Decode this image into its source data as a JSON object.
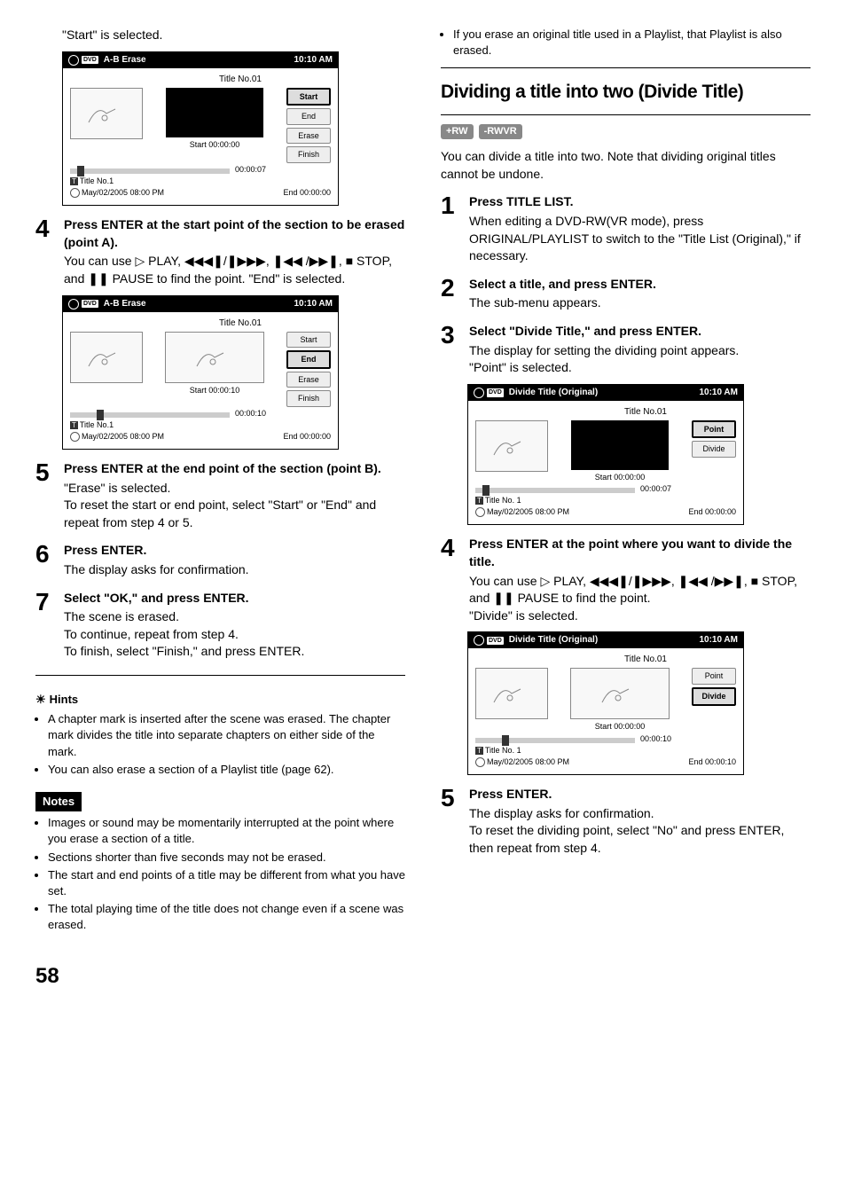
{
  "left": {
    "intro": "\"Start\" is selected.",
    "panel1": {
      "header_left": "A-B Erase",
      "header_right": "10:10 AM",
      "titleno": "Title No.01",
      "start_cap": "Start  00:00:00",
      "end_cap": "End   00:00:00",
      "elapsed": "00:00:07",
      "titleline": "Title No.1",
      "dateline": "May/02/2005  08:00  PM",
      "btns": [
        "Start",
        "End",
        "Erase",
        "Finish"
      ],
      "highlight": 0
    },
    "step4": {
      "num": "4",
      "head": "Press ENTER at the start point of the section to be erased (point A).",
      "body_a": "You can use ",
      "body_b": " PLAY, ",
      "body_c": ", ",
      "body_d": " STOP, and ",
      "body_e": " PAUSE to find the point. \"End\" is selected.",
      "play": "▷",
      "prev": "◀◀◀❚",
      "next": "❚▶▶▶",
      "skipb": "❚◀◀",
      "skipf": "▶▶❚",
      "stop": "■",
      "pause": "❚❚",
      "sep": "/"
    },
    "panel2": {
      "header_left": "A-B Erase",
      "header_right": "10:10 AM",
      "titleno": "Title No.01",
      "start_cap": "Start  00:00:10",
      "end_cap": "End   00:00:00",
      "elapsed": "00:00:10",
      "titleline": "Title No.1",
      "dateline": "May/02/2005  08:00  PM",
      "btns": [
        "Start",
        "End",
        "Erase",
        "Finish"
      ],
      "highlight": 1,
      "second_thumb": true
    },
    "step5": {
      "num": "5",
      "head": "Press ENTER at the end point of the section (point B).",
      "body": "\"Erase\" is selected.\nTo reset the start or end point, select \"Start\" or \"End\" and repeat from step 4 or 5."
    },
    "step6": {
      "num": "6",
      "head": "Press ENTER.",
      "body": "The display asks for confirmation."
    },
    "step7": {
      "num": "7",
      "head": "Select \"OK,\" and press ENTER.",
      "body": "The scene is erased.\nTo continue, repeat from step 4.\nTo finish, select \"Finish,\" and press ENTER."
    },
    "hints_head": "Hints",
    "hints": [
      "A chapter mark is inserted after the scene was erased. The chapter mark divides the title into separate chapters on either side of the mark.",
      "You can also erase a section of a Playlist title (page 62)."
    ],
    "notes_head": "Notes",
    "notes": [
      "Images or sound may be momentarily interrupted at the point where you erase a section of a title.",
      "Sections shorter than five seconds may not be erased.",
      "The start and end points of a title may be different from what you have set.",
      "The total playing time of the title does not change even if a scene was erased."
    ]
  },
  "right": {
    "top_bullet": "If you erase an original title used in a Playlist, that Playlist is also erased.",
    "section": "Dividing a title into two (Divide Title)",
    "badges": [
      "+RW",
      "-RWVR"
    ],
    "intro": "You can divide a title into two. Note that dividing original titles cannot be undone.",
    "step1": {
      "num": "1",
      "head": "Press TITLE LIST.",
      "body": "When editing a DVD-RW(VR mode), press ORIGINAL/PLAYLIST to switch to the \"Title List (Original),\" if necessary."
    },
    "step2": {
      "num": "2",
      "head": "Select a title, and press ENTER.",
      "body": "The sub-menu appears."
    },
    "step3": {
      "num": "3",
      "head": "Select \"Divide Title,\" and press ENTER.",
      "body": "The display for setting the dividing point appears.\n\"Point\" is selected."
    },
    "panel3": {
      "header_left": "Divide Title (Original)",
      "header_right": "10:10 AM",
      "titleno": "Title No.01",
      "start_cap": "Start  00:00:00",
      "end_cap": "End   00:00:00",
      "elapsed": "00:00:07",
      "titleline": "Title No. 1",
      "dateline": "May/02/2005  08:00  PM",
      "btns": [
        "Point",
        "Divide"
      ],
      "highlight": 0
    },
    "step4": {
      "num": "4",
      "head": "Press ENTER at the point where you want to divide the title.",
      "body_a": "You can use ",
      "body_b": " PLAY, ",
      "body_c": ", ",
      "body_d": " STOP, and ",
      "body_e": " PAUSE to find the point.",
      "body_f": "\"Divide\" is selected."
    },
    "panel4": {
      "header_left": "Divide Title (Original)",
      "header_right": "10:10 AM",
      "titleno": "Title No.01",
      "start_cap": "Start  00:00:00",
      "end_cap": "End   00:00:10",
      "elapsed": "00:00:10",
      "titleline": "Title No. 1",
      "dateline": "May/02/2005  08:00  PM",
      "btns": [
        "Point",
        "Divide"
      ],
      "highlight": 1,
      "second_thumb": true
    },
    "step5": {
      "num": "5",
      "head": "Press ENTER.",
      "body": "The display asks for confirmation.\nTo reset the dividing point, select \"No\" and press ENTER, then repeat from step 4."
    }
  },
  "page": "58"
}
